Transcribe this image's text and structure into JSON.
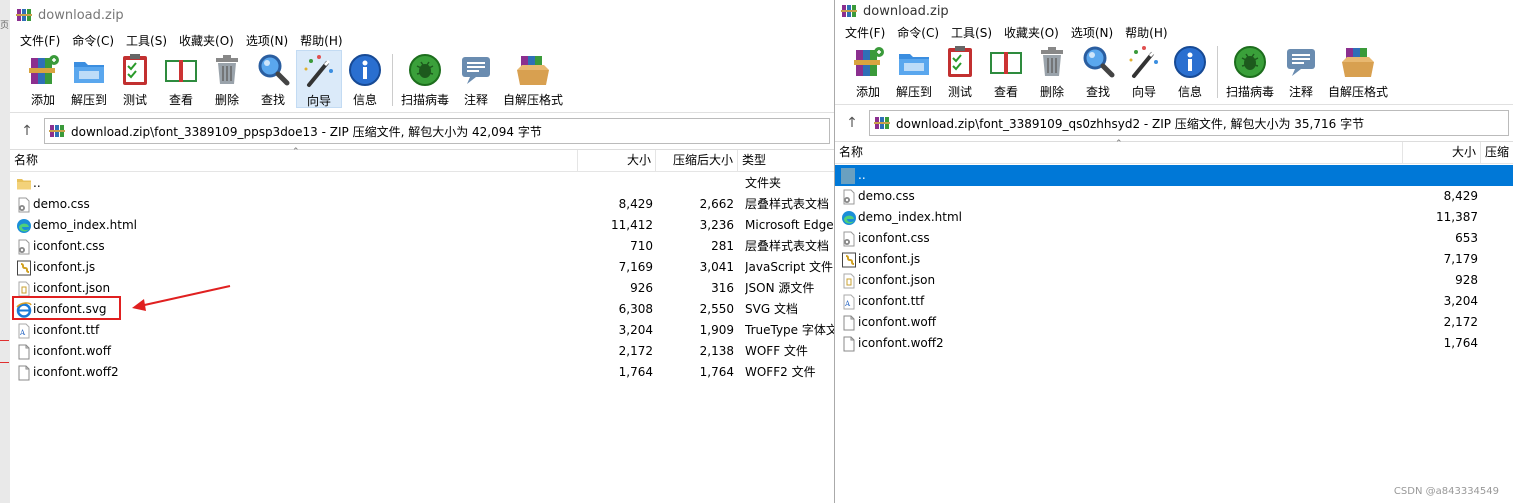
{
  "left_window": {
    "title": "download.zip",
    "menu": [
      "文件(F)",
      "命令(C)",
      "工具(S)",
      "收藏夹(O)",
      "选项(N)",
      "帮助(H)"
    ],
    "toolbar": [
      {
        "label": "添加",
        "icon": "add-archive-icon"
      },
      {
        "label": "解压到",
        "icon": "extract-folder-icon"
      },
      {
        "label": "测试",
        "icon": "test-clipboard-icon"
      },
      {
        "label": "查看",
        "icon": "view-book-icon"
      },
      {
        "label": "删除",
        "icon": "trash-icon"
      },
      {
        "label": "查找",
        "icon": "magnifier-icon"
      },
      {
        "label": "向导",
        "icon": "wizard-wand-icon",
        "active": true
      },
      {
        "label": "信息",
        "icon": "info-icon"
      },
      {
        "label": "扫描病毒",
        "icon": "virus-scan-icon"
      },
      {
        "label": "注释",
        "icon": "comment-icon"
      },
      {
        "label": "自解压格式",
        "icon": "sfx-box-icon"
      }
    ],
    "address": "download.zip\\font_3389109_ppsp3doe13 - ZIP 压缩文件, 解包大小为 42,094 字节",
    "columns": {
      "name": "名称",
      "size": "大小",
      "packed": "压缩后大小",
      "type": "类型"
    },
    "files": [
      {
        "name": "..",
        "size": "",
        "packed": "",
        "type": "文件夹",
        "icon": "folder-icon"
      },
      {
        "name": "demo.css",
        "size": "8,429",
        "packed": "2,662",
        "type": "层叠样式表文档",
        "icon": "css-file-icon"
      },
      {
        "name": "demo_index.html",
        "size": "11,412",
        "packed": "3,236",
        "type": "Microsoft Edge",
        "icon": "edge-html-icon"
      },
      {
        "name": "iconfont.css",
        "size": "710",
        "packed": "281",
        "type": "层叠样式表文档",
        "icon": "css-file-icon"
      },
      {
        "name": "iconfont.js",
        "size": "7,169",
        "packed": "3,041",
        "type": "JavaScript 文件",
        "icon": "js-file-icon"
      },
      {
        "name": "iconfont.json",
        "size": "926",
        "packed": "316",
        "type": "JSON 源文件",
        "icon": "json-file-icon"
      },
      {
        "name": "iconfont.svg",
        "size": "6,308",
        "packed": "2,550",
        "type": "SVG 文档",
        "icon": "svg-ie-icon",
        "highlighted": true
      },
      {
        "name": "iconfont.ttf",
        "size": "3,204",
        "packed": "1,909",
        "type": "TrueType 字体文",
        "icon": "ttf-file-icon"
      },
      {
        "name": "iconfont.woff",
        "size": "2,172",
        "packed": "2,138",
        "type": "WOFF 文件",
        "icon": "blank-file-icon"
      },
      {
        "name": "iconfont.woff2",
        "size": "1,764",
        "packed": "1,764",
        "type": "WOFF2 文件",
        "icon": "blank-file-icon"
      }
    ]
  },
  "right_window": {
    "title": "download.zip",
    "menu": [
      "文件(F)",
      "命令(C)",
      "工具(S)",
      "收藏夹(O)",
      "选项(N)",
      "帮助(H)"
    ],
    "toolbar": [
      {
        "label": "添加",
        "icon": "add-archive-icon"
      },
      {
        "label": "解压到",
        "icon": "extract-folder-icon"
      },
      {
        "label": "测试",
        "icon": "test-clipboard-icon"
      },
      {
        "label": "查看",
        "icon": "view-book-icon"
      },
      {
        "label": "删除",
        "icon": "trash-icon"
      },
      {
        "label": "查找",
        "icon": "magnifier-icon"
      },
      {
        "label": "向导",
        "icon": "wizard-wand-icon"
      },
      {
        "label": "信息",
        "icon": "info-icon"
      },
      {
        "label": "扫描病毒",
        "icon": "virus-scan-icon"
      },
      {
        "label": "注释",
        "icon": "comment-icon"
      },
      {
        "label": "自解压格式",
        "icon": "sfx-box-icon"
      }
    ],
    "address": "download.zip\\font_3389109_qs0zhhsyd2 - ZIP 压缩文件, 解包大小为 35,716 字节",
    "columns": {
      "name": "名称",
      "size": "大小",
      "packed": "压缩"
    },
    "files": [
      {
        "name": "..",
        "size": "",
        "icon": "folder-icon",
        "selected": true
      },
      {
        "name": "demo.css",
        "size": "8,429",
        "icon": "css-file-icon"
      },
      {
        "name": "demo_index.html",
        "size": "11,387",
        "icon": "edge-html-icon"
      },
      {
        "name": "iconfont.css",
        "size": "653",
        "icon": "css-file-icon"
      },
      {
        "name": "iconfont.js",
        "size": "7,179",
        "icon": "js-file-icon"
      },
      {
        "name": "iconfont.json",
        "size": "928",
        "icon": "json-file-icon"
      },
      {
        "name": "iconfont.ttf",
        "size": "3,204",
        "icon": "ttf-file-icon"
      },
      {
        "name": "iconfont.woff",
        "size": "2,172",
        "icon": "blank-file-icon"
      },
      {
        "name": "iconfont.woff2",
        "size": "1,764",
        "icon": "blank-file-icon"
      }
    ]
  },
  "watermark": "CSDN @a843334549",
  "colors": {
    "selection": "#0078d7",
    "annotation_red": "#e02020",
    "active_tool": "#dbeaf9"
  }
}
